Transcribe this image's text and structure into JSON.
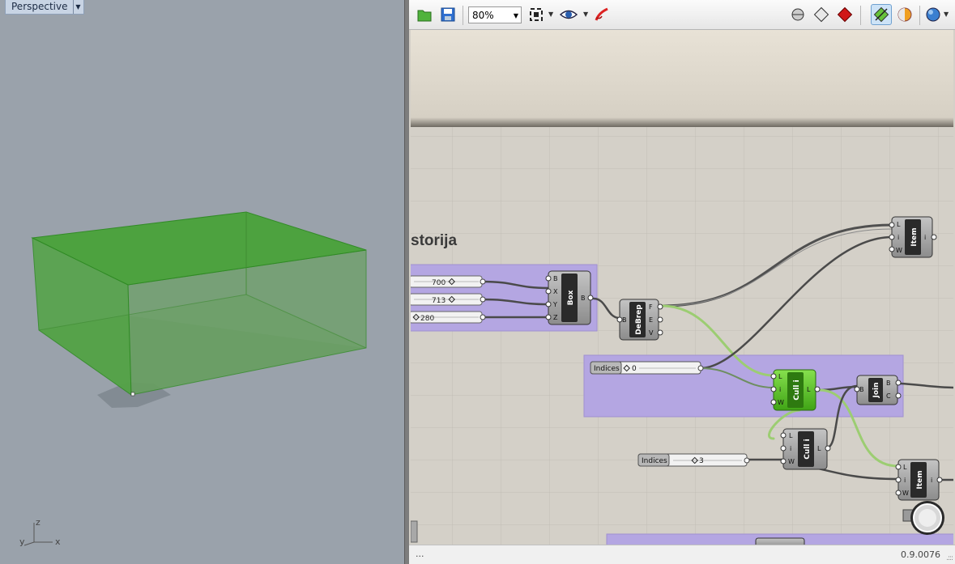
{
  "viewport": {
    "title": "Perspective",
    "axes": {
      "z": "z",
      "y": "y",
      "x": "x"
    }
  },
  "toolbar": {
    "zoom_value": "80%",
    "icons": [
      "open-file-icon",
      "save-icon",
      "zoom-extents-icon",
      "preview-eye-icon",
      "sketch-icon",
      "preview-wireframe-icon",
      "preview-shaded-icon",
      "preview-selected-icon",
      "document-preview-icon",
      "material-icon",
      "sphere-icon"
    ]
  },
  "canvas": {
    "group_label": "storija",
    "sliders": [
      {
        "value": "700"
      },
      {
        "value": "713"
      },
      {
        "value": "280"
      }
    ],
    "indices_sliders": [
      {
        "label": "Indices",
        "value": "0"
      },
      {
        "label": "Indices",
        "value": "3"
      }
    ],
    "components": {
      "box": {
        "name": "Box",
        "inputs": [
          "B",
          "X",
          "Y",
          "Z"
        ],
        "outputs": [
          "B"
        ]
      },
      "debrep": {
        "name": "DeBrep",
        "inputs": [
          "B"
        ],
        "outputs": [
          "F",
          "E",
          "V"
        ]
      },
      "item_top": {
        "name": "Item",
        "inputs": [
          "L",
          "i",
          "W"
        ],
        "outputs": [
          "i"
        ]
      },
      "cull_a": {
        "name": "Cull i",
        "inputs": [
          "L",
          "i",
          "W"
        ],
        "outputs": [
          "L"
        ]
      },
      "join": {
        "name": "Join",
        "inputs": [
          "B"
        ],
        "outputs": [
          "B",
          "C"
        ]
      },
      "cull_b": {
        "name": "Cull i",
        "inputs": [
          "L",
          "i",
          "W"
        ],
        "outputs": [
          "L"
        ]
      },
      "item_bottom": {
        "name": "Item",
        "inputs": [
          "L",
          "i",
          "W"
        ],
        "outputs": [
          "i"
        ]
      }
    }
  },
  "statusbar": {
    "left": "...",
    "version": "0.9.0076"
  },
  "colors": {
    "viewport_bg": "#9aa2ab",
    "box_fill": "#4caa3c",
    "group_fill": "#b3a2e0",
    "canvas_bg": "#d4d0c8",
    "selected_component": "#56c324"
  }
}
